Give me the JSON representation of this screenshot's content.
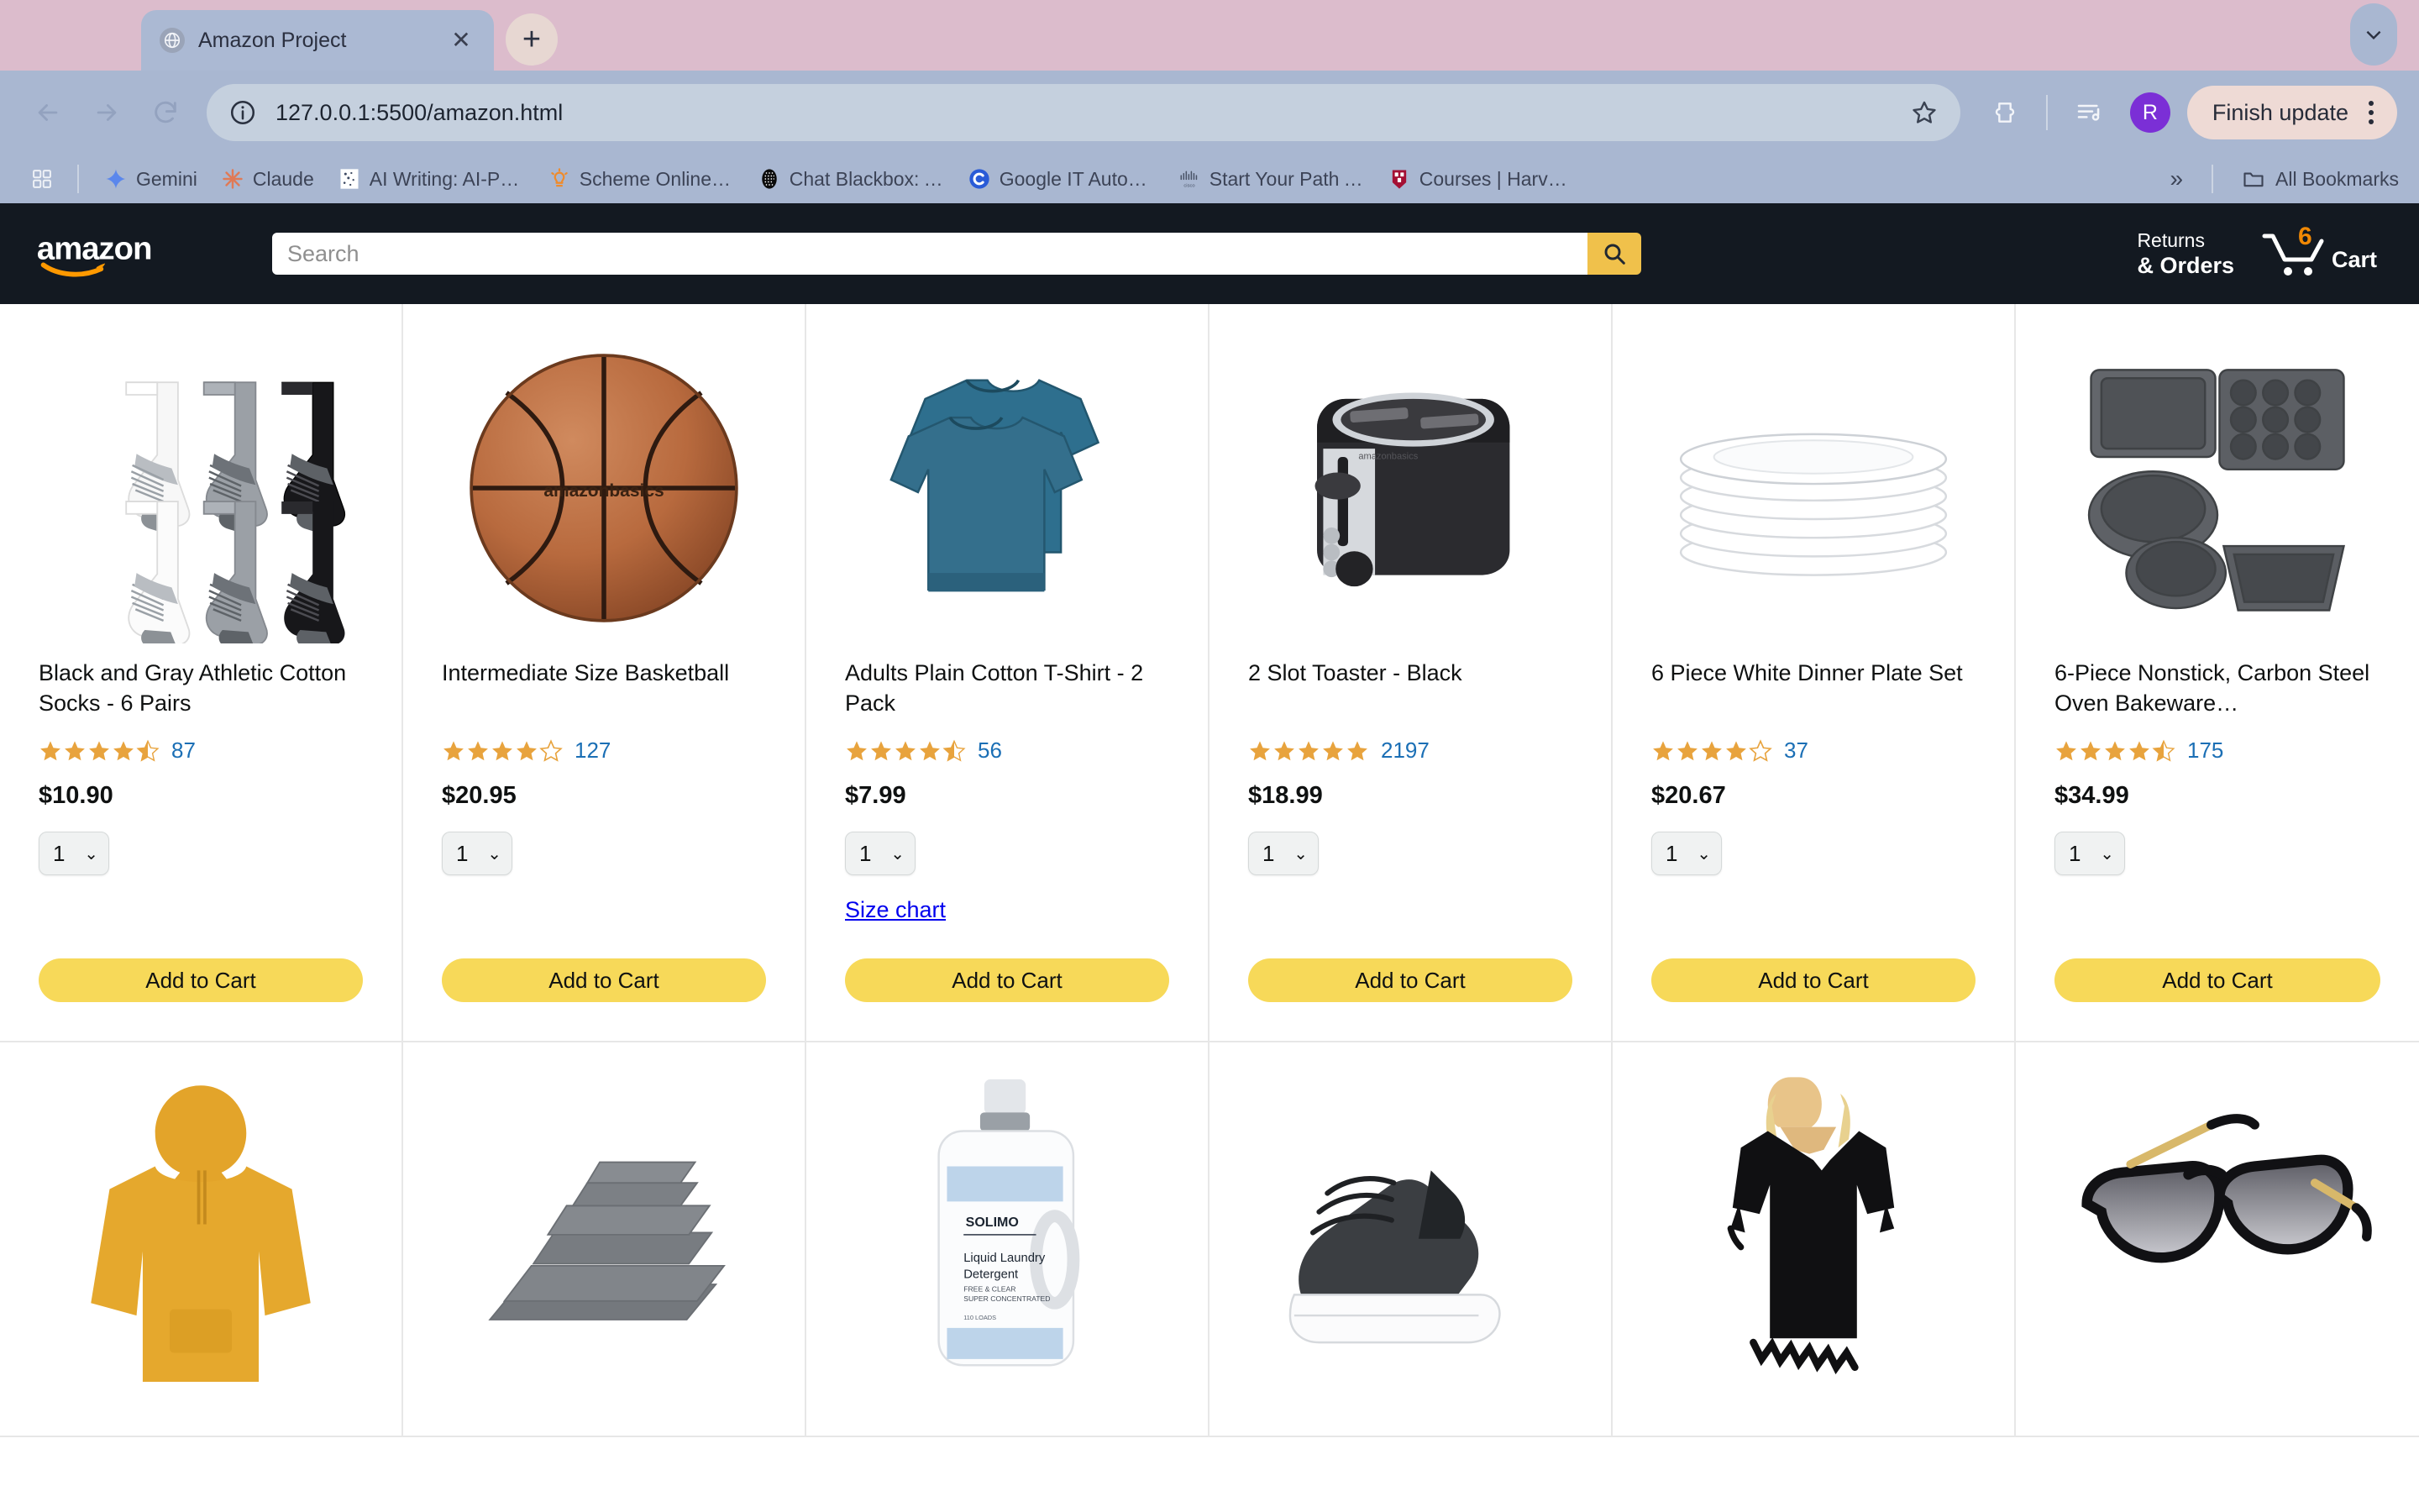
{
  "browser": {
    "tab": {
      "title": "Amazon Project",
      "favicon": "globe-icon",
      "close": "✕"
    },
    "new_tab_label": "+",
    "tabstrip_chevron": "chevron-down-icon",
    "nav": {
      "back": "back-arrow-icon",
      "forward": "forward-arrow-icon",
      "reload": "reload-icon"
    },
    "omnibox": {
      "url": "127.0.0.1:5500/amazon.html",
      "info_icon": "site-info-icon",
      "bookmark_icon": "star-icon"
    },
    "toolbar_icons": [
      "extensions-icon",
      "reading-list-icon"
    ],
    "profile_initial": "R",
    "update_button": "Finish update",
    "menu_icon": "kebab-menu-icon",
    "bookmarks": {
      "apps_icon": "apps-grid-icon",
      "items": [
        {
          "label": "Gemini",
          "icon": "gemini-sparkle-icon"
        },
        {
          "label": "Claude",
          "icon": "claude-asterisk-icon"
        },
        {
          "label": "AI Writing: AI-Pow...",
          "icon": "ai-writing-icon"
        },
        {
          "label": "Scheme Online Edi...",
          "icon": "scheme-lightbulb-icon"
        },
        {
          "label": "Chat Blackbox: AI...",
          "icon": "blackbox-icon"
        },
        {
          "label": "Google IT Automat...",
          "icon": "coursera-icon"
        },
        {
          "label": "Start Your Path As...",
          "icon": "cisco-icon"
        },
        {
          "label": "Courses | Harvard...",
          "icon": "harvard-shield-icon"
        }
      ],
      "overflow": "»",
      "all_bookmarks": {
        "label": "All Bookmarks",
        "icon": "folder-icon"
      }
    }
  },
  "amazon": {
    "logo_text": "amazon",
    "search": {
      "placeholder": "Search",
      "value": "",
      "button_icon": "search-icon"
    },
    "returns": {
      "line1": "Returns",
      "line2": "& Orders"
    },
    "cart": {
      "quantity": "6",
      "label": "Cart",
      "icon": "shopping-cart-icon"
    },
    "colors": {
      "header_bg": "#131921",
      "search_button": "#f0c14b",
      "add_to_cart": "#f7d959",
      "star": "#e8a33d",
      "rating_link": "#1b6fb5",
      "link": "#0000ee"
    },
    "products": [
      {
        "image": "athletic-socks-image",
        "title": "Black and Gray Athletic Cotton Socks - 6 Pairs",
        "stars": 4.5,
        "rating_count": "87",
        "price": "$10.90",
        "quantity": "1",
        "size_chart": null,
        "add_to_cart": "Add to Cart"
      },
      {
        "image": "basketball-image",
        "title": "Intermediate Size Basketball",
        "stars": 4,
        "rating_count": "127",
        "price": "$20.95",
        "quantity": "1",
        "size_chart": null,
        "add_to_cart": "Add to Cart"
      },
      {
        "image": "tshirt-image",
        "title": "Adults Plain Cotton T-Shirt - 2 Pack",
        "stars": 4.5,
        "rating_count": "56",
        "price": "$7.99",
        "quantity": "1",
        "size_chart": "Size chart",
        "add_to_cart": "Add to Cart"
      },
      {
        "image": "toaster-image",
        "title": "2 Slot Toaster - Black",
        "stars": 5,
        "rating_count": "2197",
        "price": "$18.99",
        "quantity": "1",
        "size_chart": null,
        "add_to_cart": "Add to Cart"
      },
      {
        "image": "dinner-plates-image",
        "title": "6 Piece White Dinner Plate Set",
        "stars": 4,
        "rating_count": "37",
        "price": "$20.67",
        "quantity": "1",
        "size_chart": null,
        "add_to_cart": "Add to Cart"
      },
      {
        "image": "bakeware-set-image",
        "title": "6-Piece Nonstick, Carbon Steel Oven Bakeware…",
        "stars": 4.5,
        "rating_count": "175",
        "price": "$34.99",
        "quantity": "1",
        "size_chart": null,
        "add_to_cart": "Add to Cart"
      }
    ],
    "products_row2": [
      {
        "image": "yellow-hoodie-image"
      },
      {
        "image": "gray-towel-set-image"
      },
      {
        "image": "laundry-detergent-image"
      },
      {
        "image": "sneaker-image"
      },
      {
        "image": "black-cover-up-dress-image"
      },
      {
        "image": "sunglasses-image"
      }
    ]
  }
}
